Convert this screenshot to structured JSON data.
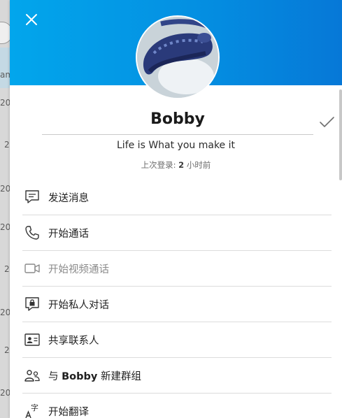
{
  "background": {
    "fragments": [
      "am",
      "20",
      "2",
      "20",
      "2",
      "20",
      "2",
      "20",
      "2",
      "20",
      "2"
    ]
  },
  "profile": {
    "name": "Bobby",
    "status_message": "Life is What you make it",
    "last_seen_prefix": "上次登录: ",
    "last_seen_value": "2",
    "last_seen_suffix": " 小时前"
  },
  "menu": {
    "items": [
      {
        "label": "发送消息",
        "icon": "chat-icon",
        "enabled": true
      },
      {
        "label": "开始通话",
        "icon": "phone-icon",
        "enabled": true
      },
      {
        "label": "开始视频通话",
        "icon": "video-camera-icon",
        "enabled": false
      },
      {
        "label": "开始私人对话",
        "icon": "private-chat-lock-icon",
        "enabled": true
      },
      {
        "label": "共享联系人",
        "icon": "contact-card-icon",
        "enabled": true
      },
      {
        "label_prefix": "与 ",
        "label_name": "Bobby",
        "label_suffix": " 新建群组",
        "icon": "group-icon",
        "enabled": true
      },
      {
        "label": "开始翻译",
        "icon": "translate-icon",
        "enabled": true
      }
    ]
  },
  "colors": {
    "header_start": "#02a6ec",
    "header_end": "#0678d7",
    "icon": "#333333",
    "disabled": "#8a8a8a"
  }
}
